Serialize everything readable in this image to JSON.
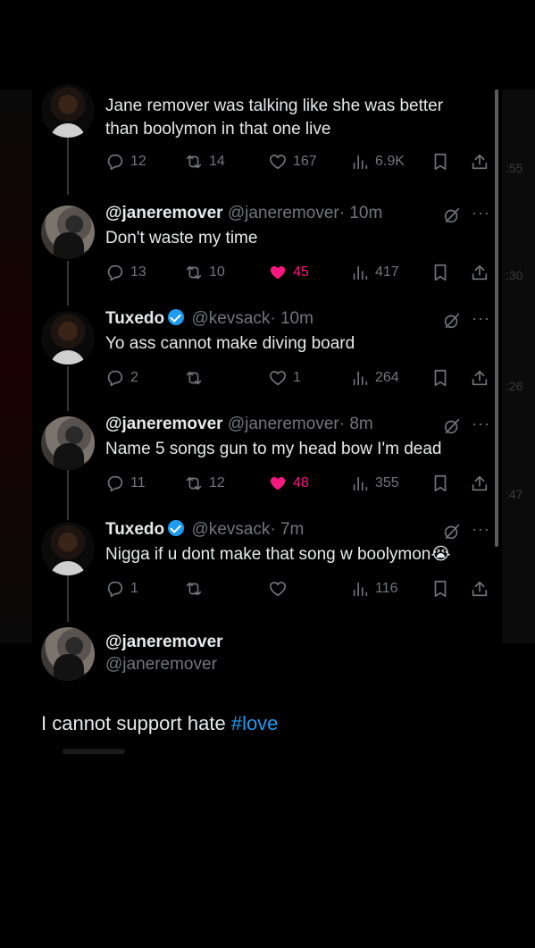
{
  "side_timestamps": [
    ":55",
    ":30",
    ":26",
    ":47"
  ],
  "tweets": [
    {
      "name": "",
      "handle": "",
      "time": "",
      "text": "Jane remover was talking like she was better than boolymon in that one live",
      "replies": "12",
      "reposts": "14",
      "likes": "167",
      "views": "6.9K",
      "liked": false,
      "avatar": "tux"
    },
    {
      "name": "@janeremover",
      "handle": "@janeremover",
      "time": "· 10m",
      "text": "Don't waste my time",
      "replies": "13",
      "reposts": "10",
      "likes": "45",
      "views": "417",
      "liked": true,
      "avatar": "jane"
    },
    {
      "name": "Tuxedo",
      "handle": "@kevsack",
      "time": "· 10m",
      "text": "Yo ass cannot make diving board",
      "replies": "2",
      "reposts": "",
      "likes": "1",
      "views": "264",
      "liked": false,
      "avatar": "tux",
      "verified": true
    },
    {
      "name": "@janeremover",
      "handle": "@janeremover",
      "time": "· 8m",
      "text": "Name 5 songs gun to my head bow I'm dead",
      "replies": "11",
      "reposts": "12",
      "likes": "48",
      "views": "355",
      "liked": true,
      "avatar": "jane"
    },
    {
      "name": "Tuxedo",
      "handle": "@kevsack",
      "time": "· 7m",
      "text": "Nigga if u dont make that song w boolymon😭",
      "replies": "1",
      "reposts": "",
      "likes": "",
      "views": "116",
      "liked": false,
      "avatar": "tux",
      "verified": true
    }
  ],
  "final": {
    "name": "@janeremover",
    "handle": "@janeremover",
    "text_plain": "I cannot support hate ",
    "hashtag": "#love"
  },
  "colors": {
    "like_active": "#f91880",
    "verified": "#1d9bf0",
    "hashtag": "#1d9bf0",
    "muted": "#71767b"
  },
  "icons": [
    "reply-icon",
    "repost-icon",
    "like-icon",
    "views-icon",
    "bookmark-icon",
    "share-icon",
    "grok-icon",
    "more-icon",
    "verified-icon"
  ]
}
